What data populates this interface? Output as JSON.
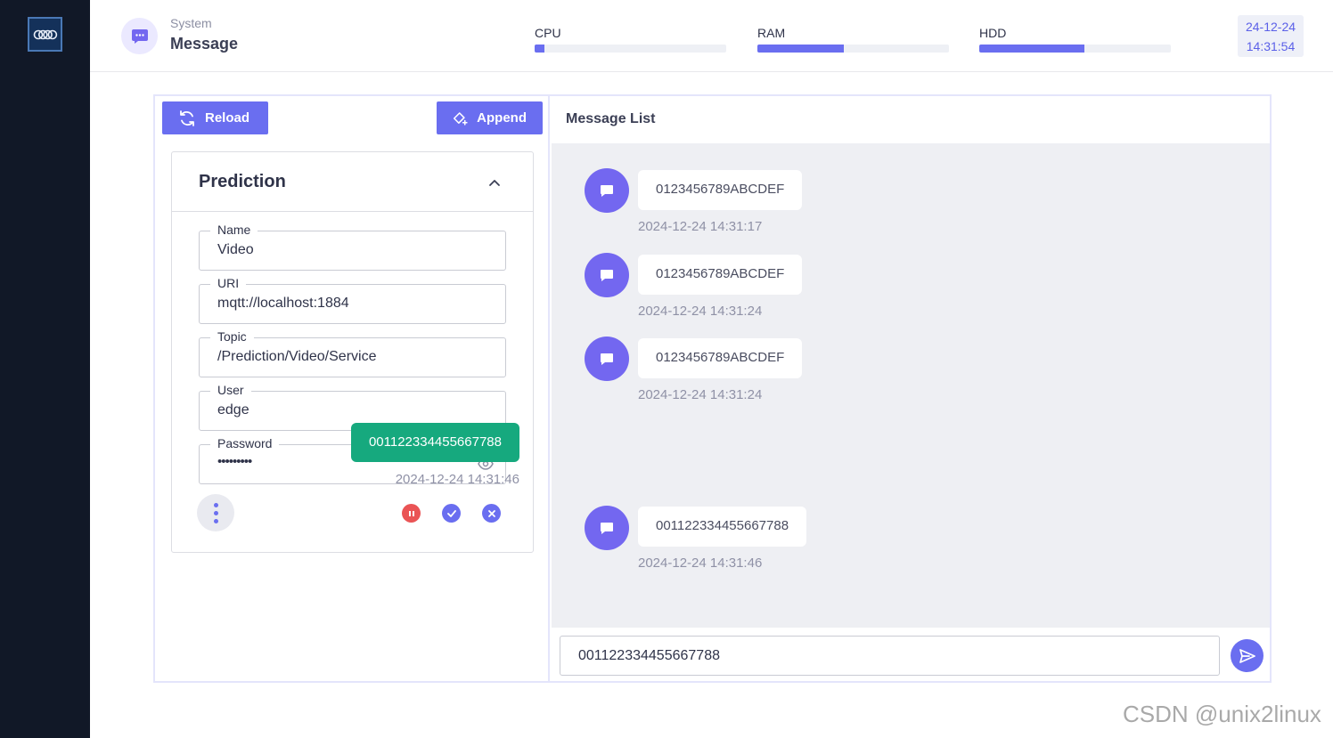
{
  "header": {
    "section": "System",
    "title": "Message",
    "meters": [
      {
        "label": "CPU",
        "fraction": 0.05
      },
      {
        "label": "RAM",
        "fraction": 0.45
      },
      {
        "label": "HDD",
        "fraction": 0.55
      }
    ],
    "date": "24-12-24",
    "time": "14:31:54"
  },
  "toolbar": {
    "reload_label": "Reload",
    "append_label": "Append"
  },
  "config": {
    "title": "Prediction",
    "fields": {
      "name": {
        "label": "Name",
        "value": "Video"
      },
      "uri": {
        "label": "URI",
        "value": "mqtt://localhost:1884"
      },
      "topic": {
        "label": "Topic",
        "value": "/Prediction/Video/Service"
      },
      "user": {
        "label": "User",
        "value": "edge"
      },
      "password": {
        "label": "Password",
        "value": "•••••••••"
      }
    },
    "status_colors": {
      "pause": "#ea5455",
      "connect": "#6a6ef0",
      "disconnect": "#6a6ef0"
    }
  },
  "messages": {
    "title": "Message List",
    "items": [
      {
        "direction": "received",
        "text": "0123456789ABCDEF",
        "time": "2024-12-24 14:31:17"
      },
      {
        "direction": "received",
        "text": "0123456789ABCDEF",
        "time": "2024-12-24 14:31:24"
      },
      {
        "direction": "received",
        "text": "0123456789ABCDEF",
        "time": "2024-12-24 14:31:24"
      },
      {
        "direction": "sent",
        "text": "001122334455667788",
        "time": "2024-12-24 14:31:46"
      },
      {
        "direction": "received",
        "text": "001122334455667788",
        "time": "2024-12-24 14:31:46"
      }
    ],
    "input_value": "001122334455667788",
    "sent_color": "#16a97e",
    "accent": "#6a6ef0"
  },
  "watermark": "CSDN @unix2linux"
}
